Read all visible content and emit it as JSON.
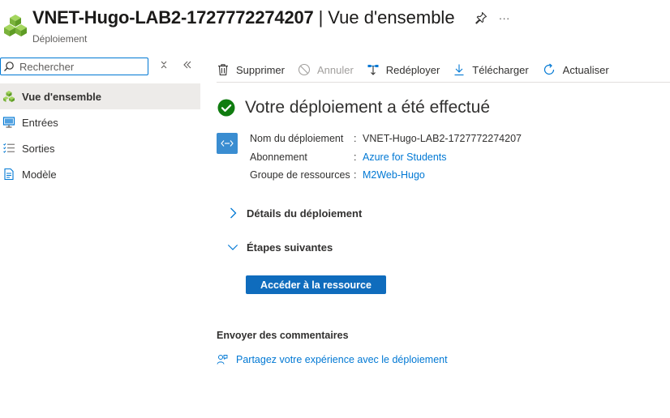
{
  "header": {
    "title": "VNET-Hugo-LAB2-1727772274207",
    "separator": "|",
    "section": "Vue d'ensemble",
    "subtitle": "Déploiement",
    "more": "···"
  },
  "sidebar": {
    "search_placeholder": "Rechercher",
    "items": [
      {
        "label": "Vue d'ensemble",
        "icon": "overview-cubes-icon",
        "active": true
      },
      {
        "label": "Entrées",
        "icon": "inputs-monitor-icon",
        "active": false
      },
      {
        "label": "Sorties",
        "icon": "outputs-list-icon",
        "active": false
      },
      {
        "label": "Modèle",
        "icon": "template-document-icon",
        "active": false
      }
    ]
  },
  "toolbar": {
    "delete": "Supprimer",
    "cancel": "Annuler",
    "redeploy": "Redéployer",
    "download": "Télécharger",
    "refresh": "Actualiser"
  },
  "main": {
    "status_title": "Votre déploiement a été effectué",
    "details": [
      {
        "label": "Nom du déploiement",
        "value": "VNET-Hugo-LAB2-1727772274207",
        "link": false
      },
      {
        "label": "Abonnement",
        "value": "Azure for Students",
        "link": true
      },
      {
        "label": "Groupe de ressources",
        "value": "M2Web-Hugo",
        "link": true
      }
    ],
    "colon": ":",
    "deployment_details": "Détails du déploiement",
    "next_steps": "Étapes suivantes",
    "go_to_resource": "Accéder à la ressource",
    "feedback_title": "Envoyer des commentaires",
    "feedback_link": "Partagez votre expérience avec le déploiement"
  },
  "colors": {
    "accent": "#0078d4",
    "success": "#107c10",
    "primary_button": "#0f6cbd",
    "active_nav": "#edebe9"
  }
}
